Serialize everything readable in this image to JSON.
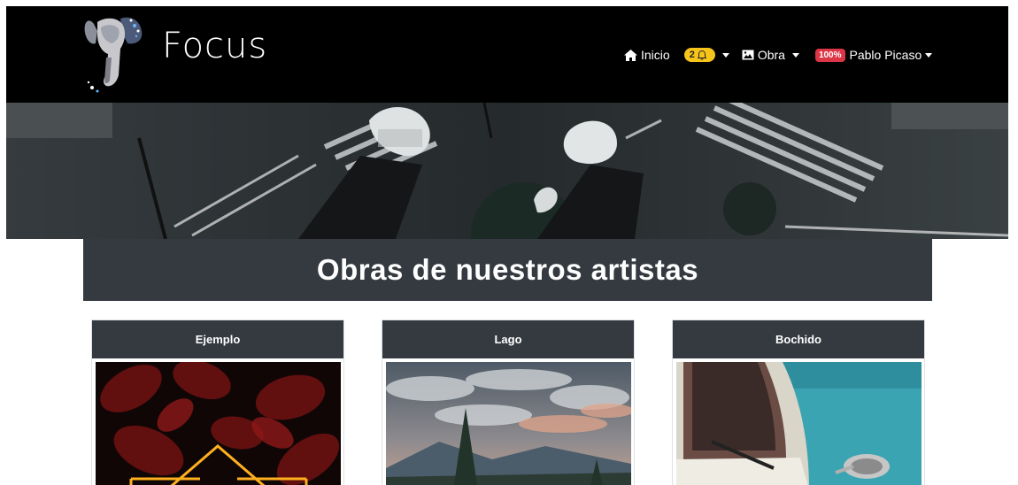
{
  "navbar": {
    "brand": "Focus",
    "logo_icon": "elephant-logo",
    "items": {
      "inicio": {
        "label": "Inicio",
        "icon": "home-icon"
      },
      "notifications": {
        "count": "2",
        "icon": "bell-icon"
      },
      "obra": {
        "label": "Obra",
        "icon": "image-icon"
      },
      "user": {
        "badge": "100%",
        "name": "Pablo Picaso"
      }
    }
  },
  "hero": {
    "image": "city-street-feet-photo"
  },
  "main": {
    "title": "Obras de nuestros artistas",
    "cards": [
      {
        "title": "Ejemplo",
        "image": "red-leaves-neon-triangle"
      },
      {
        "title": "Lago",
        "image": "lake-mountains-sunset"
      },
      {
        "title": "Bochido",
        "image": "vintage-car-teal"
      }
    ]
  },
  "colors": {
    "navbar_bg": "#000000",
    "header_bg": "#343a40",
    "notif_badge": "#f6c41b",
    "user_badge": "#dc3545"
  }
}
